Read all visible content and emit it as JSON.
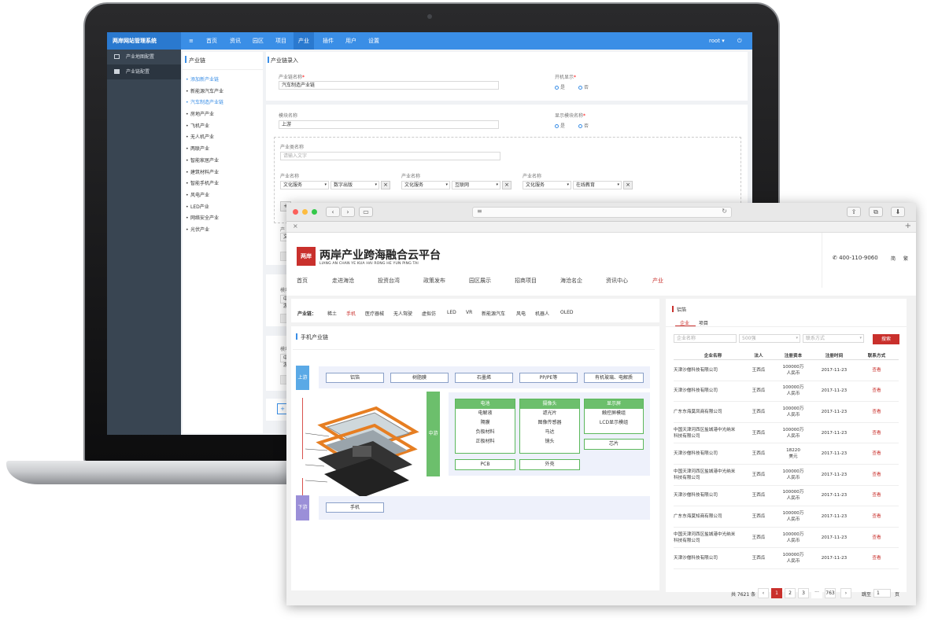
{
  "admin": {
    "brand": "两岸网站管理系统",
    "nav": [
      "首页",
      "资讯",
      "园区",
      "项目",
      "产业",
      "插件",
      "用户",
      "设置"
    ],
    "user": "root ▾",
    "sidebar": [
      "产业地图配置",
      "产业链配置"
    ],
    "tree_title": "产业链",
    "tree_items": [
      "添加新产业链",
      "新能源汽车产业",
      "汽车制造产业链",
      "房地产产业",
      "飞机产业",
      "无人机产业",
      "两联产业",
      "智能家居产业",
      "建筑材料产业",
      "智能手机产业",
      "风电产业",
      "LED产业",
      "网络安全产业",
      "光伏产业"
    ],
    "form_title": "产业链录入",
    "chain_name_label": "产业链名称",
    "chain_name_value": "汽车制造产业链",
    "open_label": "开机显示",
    "yes": "是",
    "no": "否",
    "module_label": "模块名称",
    "module_value": "上游",
    "show_module_label": "显示模块名称",
    "industry_class_label": "产业类名称",
    "industry_class_placeholder": "请输入文字",
    "industry_name_label": "产业名称",
    "groups": [
      [
        "文化服务",
        "数字出版"
      ],
      [
        "文化服务",
        "互联网"
      ],
      [
        "文化服务",
        "在线教育"
      ]
    ],
    "plus": "+",
    "x": "×",
    "star": "*",
    "cut_label_a": "产",
    "cut_label_b": "文",
    "cut_label_c": "模块",
    "cut_label_d": "中游"
  },
  "site": {
    "logo_title": "两岸产业跨海融合云平台",
    "logo_sub": "LIANG AN CHAN YE KUA HAI RONG HE YUN PING TAI",
    "logo_mark": "两岸",
    "phone": "400-110-9060",
    "lang": [
      "简",
      "繁"
    ],
    "menu": [
      "首页",
      "走进海沧",
      "投资台湾",
      "政策发布",
      "园区展示",
      "招商项目",
      "海沧名企",
      "资讯中心",
      "产业"
    ],
    "chain_label": "产业链：",
    "chips": [
      "稀土",
      "手机",
      "医疗器械",
      "无人驾驶",
      "虚拟仿",
      "LED",
      "VR",
      "新能源汽车",
      "风电",
      "机器人",
      "OLED"
    ],
    "diagram_title": "手机产业链",
    "up": "上游",
    "mid": "中游",
    "down": "下游",
    "up_items": [
      "铝箔",
      "树脂膜",
      "石墨烯",
      "PP/PE等",
      "有机玻璃、电解质"
    ],
    "cols": [
      {
        "h": "电池",
        "rows": [
          "电解液",
          "隔膜",
          "负极材料",
          "正极材料"
        ]
      },
      {
        "h": "摄像头",
        "rows": [
          "滤光片",
          "图像传感器",
          "马达",
          "镜头"
        ]
      },
      {
        "h": "显示屏",
        "rows": [
          "触控屏模组",
          "LCD显示模组"
        ]
      }
    ],
    "chip_item": "芯片",
    "pcb": "PCB",
    "shell": "外壳",
    "down_item": "手机",
    "right_title": "铝箔",
    "tabs": [
      "企业",
      "项目"
    ],
    "filters": [
      "企业名称",
      "500强",
      "联系方式"
    ],
    "search": "搜索",
    "headers": [
      "企业名称",
      "法人",
      "注册资本",
      "注册时间",
      "联系方式"
    ],
    "rows": [
      [
        "天津沙僧科技有限公司",
        "王西瓜",
        "100000万\n人民币",
        "2017-11-23",
        "查看"
      ],
      [
        "天津沙僧科技有限公司",
        "王西瓜",
        "100000万\n人民币",
        "2017-11-23",
        "查看"
      ],
      [
        "广东东海莫凤商有限公司",
        "王西瓜",
        "100000万\n人民币",
        "2017-11-23",
        "查看"
      ],
      [
        "中国天津河西区盐城港中光纳米\n科技有限公司",
        "王西瓜",
        "100000万\n人民币",
        "2017-11-23",
        "查看"
      ],
      [
        "天津沙僧科技有限公司",
        "王西瓜",
        "18220\n美元",
        "2017-11-23",
        "查看"
      ],
      [
        "中国天津河西区盐城港中光纳米\n科技有限公司",
        "王西瓜",
        "100000万\n人民币",
        "2017-11-23",
        "查看"
      ],
      [
        "天津沙僧科技有限公司",
        "王西瓜",
        "100000万\n人民币",
        "2017-11-23",
        "查看"
      ],
      [
        "广东东海莫知商有限公司",
        "王西瓜",
        "100000万\n人民币",
        "2017-11-23",
        "查看"
      ],
      [
        "中国天津河西区盐城港中光纳米\n科技有限公司",
        "王西瓜",
        "100000万\n人民币",
        "2017-11-23",
        "查看"
      ],
      [
        "天津沙僧科技有限公司",
        "王西瓜",
        "100000万\n人民币",
        "2017-11-23",
        "查看"
      ]
    ],
    "total": "共 7621 条",
    "pages": [
      "‹",
      "1",
      "2",
      "3",
      "···",
      "763",
      "›"
    ],
    "jump": "跳至",
    "page_word": "页",
    "jump_value": "1"
  },
  "colors": {
    "admin_blue": "#3a8ee6",
    "sidebar": "#394552",
    "site_red": "#c9302c",
    "green": "#6cbf6c",
    "up_blue": "#5aa9e6",
    "down_purple": "#9b8fd8"
  }
}
